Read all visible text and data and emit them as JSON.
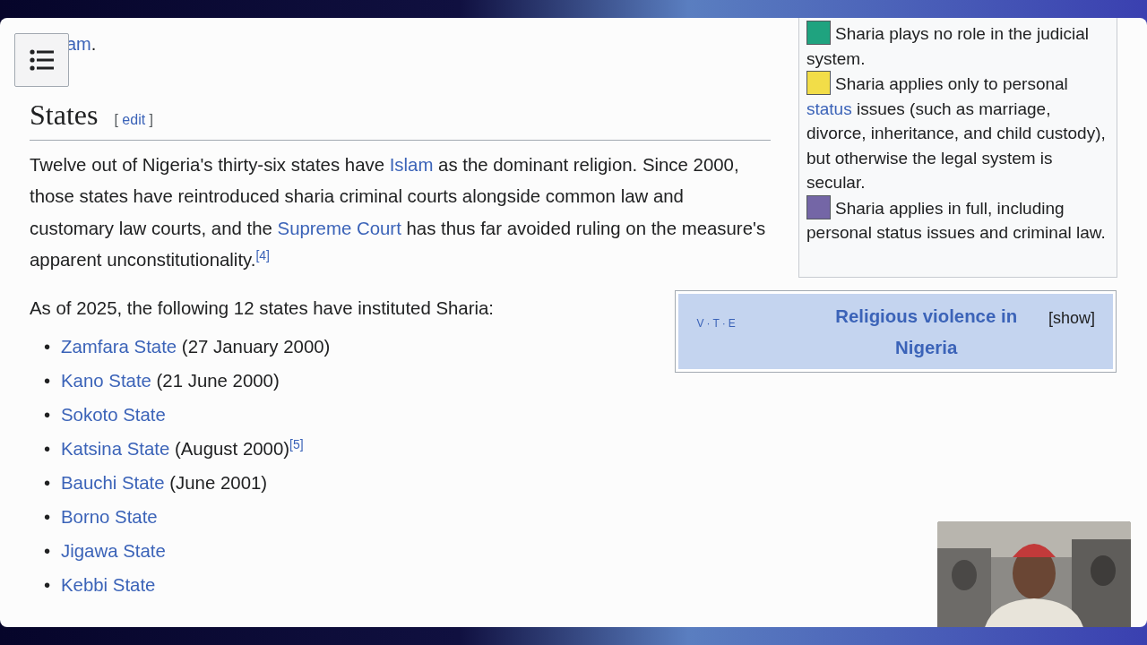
{
  "previous_paragraph": {
    "link": "am",
    "tail": "."
  },
  "section": {
    "title": "States",
    "edit_open": "[",
    "edit": "edit",
    "edit_close": "]"
  },
  "paragraph": [
    {
      "kind": "text",
      "text": "Twelve out of Nigeria's thirty-six states have "
    },
    {
      "kind": "link",
      "text": "Islam"
    },
    {
      "kind": "text",
      "text": " as the dominant religion. Since 2000, those states have reintroduced sharia criminal courts alongside common law and customary law courts, and the "
    },
    {
      "kind": "link",
      "text": "Supreme Court"
    },
    {
      "kind": "text",
      "text": " has thus far avoided ruling on the measure's apparent unconstitutionality."
    },
    {
      "kind": "ref",
      "text": "[4]"
    }
  ],
  "intro": "As of 2025, the following 12 states have instituted Sharia:",
  "bullet": "•",
  "states": [
    {
      "name": "Zamfara State",
      "note": " (27 January 2000)"
    },
    {
      "name": "Kano State",
      "note": " (21 June 2000)"
    },
    {
      "name": "Sokoto State"
    },
    {
      "name": "Katsina State",
      "note": " (August 2000)",
      "ref": "[5]"
    },
    {
      "name": "Bauchi State",
      "note": " (June 2001)"
    },
    {
      "name": "Borno State"
    },
    {
      "name": "Jigawa State"
    },
    {
      "name": "Kebbi State"
    }
  ],
  "legend": [
    {
      "color": "#1fa37f",
      "parts": [
        {
          "kind": "text",
          "text": "Sharia plays no role in the judicial system."
        }
      ]
    },
    {
      "color": "#f2dd48",
      "parts": [
        {
          "kind": "text",
          "text": "Sharia applies only to personal "
        },
        {
          "kind": "link",
          "text": "status"
        },
        {
          "kind": "text",
          "text": " issues (such as marriage, divorce, inheritance, and child custody), but otherwise the legal system is secular."
        }
      ]
    },
    {
      "color": "#7466a6",
      "parts": [
        {
          "kind": "text",
          "text": "Sharia applies in full, including personal status issues and criminal law."
        }
      ]
    }
  ],
  "navbox": {
    "vte": [
      "V",
      "T",
      "E"
    ],
    "separator": "·",
    "title": "Religious violence in Nigeria",
    "toggle": "[show]"
  }
}
